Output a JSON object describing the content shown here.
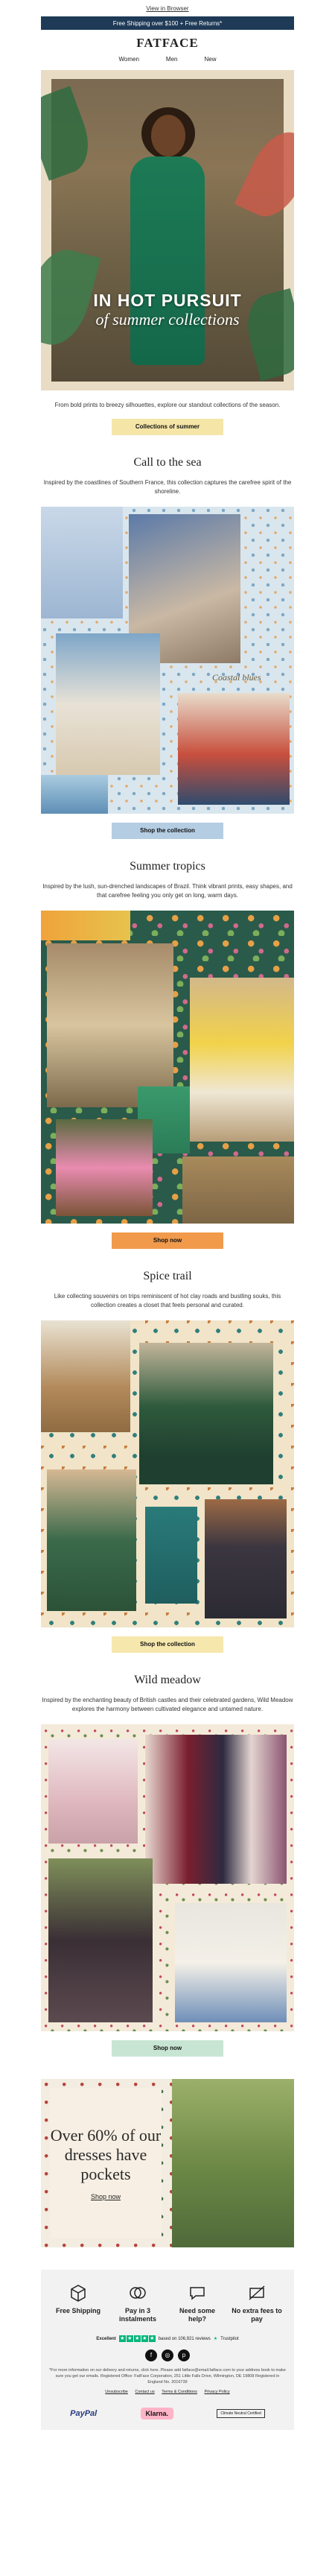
{
  "header": {
    "view_browser": "View in Browser",
    "shipping": "Free Shipping over $100 + Free Returns*",
    "logo": "FATFACE",
    "nav": [
      "Women",
      "Men",
      "New"
    ]
  },
  "hero": {
    "title": "IN HOT PURSUIT",
    "subtitle": "of summer collections",
    "intro": "From bold prints to breezy silhouettes, explore our standout collections of the season.",
    "cta": "Collections of summer"
  },
  "sections": [
    {
      "title": "Call to the sea",
      "text": "Inspired by the coastlines of Southern France, this collection captures the carefree spirit of the shoreline.",
      "caption": "Coastal blues",
      "cta": "Shop the collection",
      "color": "#b5cde3"
    },
    {
      "title": "Summer tropics",
      "text": "Inspired by the lush, sun-drenched landscapes of Brazil. Think vibrant prints, easy shapes, and that carefree feeling you only get on long, warm days.",
      "cta": "Shop now",
      "color": "#f19a4c"
    },
    {
      "title": "Spice trail",
      "text": "Like collecting souvenirs on trips reminiscent of hot clay roads and bustling souks, this collection creates a closet that feels personal and curated.",
      "cta": "Shop the collection",
      "color": "#f6e7ad"
    },
    {
      "title": "Wild meadow",
      "text": "Inspired by the enchanting beauty of British castles and their celebrated gardens, Wild Meadow explores the harmony between cultivated elegance and untamed nature.",
      "cta": "Shop now",
      "color": "#c8e5d4"
    }
  ],
  "pockets": {
    "headline": "Over 60% of our dresses have pockets",
    "cta": "Shop now"
  },
  "footer": {
    "usps": [
      {
        "icon": "box-icon",
        "label": "Free Shipping"
      },
      {
        "icon": "coins-icon",
        "label": "Pay in 3 instalments"
      },
      {
        "icon": "chat-icon",
        "label": "Need some help?"
      },
      {
        "icon": "no-fees-icon",
        "label": "No extra fees to pay"
      }
    ],
    "trustpilot": {
      "label": "Excellent",
      "reviews": "based on 106,921 reviews",
      "brand": "Trustpilot"
    },
    "fine_print": "*For more information on our delivery and returns, click here. Please add fatface@email.fatface.com to your address book to make sure you get our emails. Registered Office: FatFace Corporation, 251 Little Falls Drive, Wilmington, DE 19808 Registered in England No. 2016739",
    "links": [
      "Unsubscribe",
      "Contact us",
      "Terms & Conditions",
      "Privacy Policy"
    ],
    "payments": [
      "PayPal",
      "Klarna.",
      "Climate Neutral Certified"
    ]
  }
}
